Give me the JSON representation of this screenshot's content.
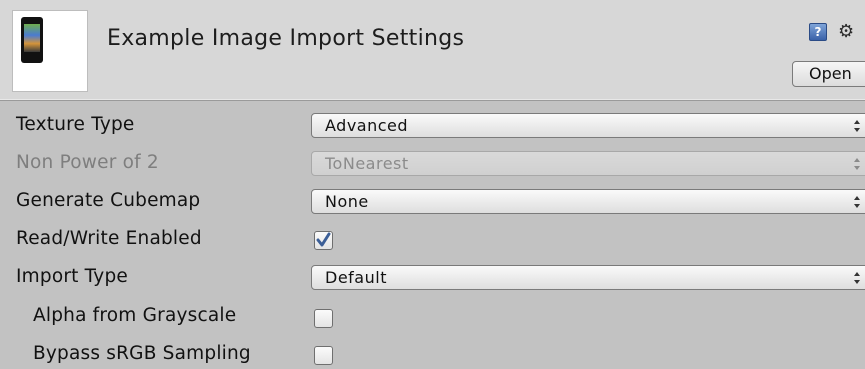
{
  "header": {
    "title": "Example Image Import Settings",
    "thumbnail_icon": "image-thumbnail-icon",
    "help_icon_glyph": "?",
    "gear_icon_glyph": "⚙",
    "open_label": "Open"
  },
  "settings": {
    "texture_type": {
      "label": "Texture Type",
      "value": "Advanced"
    },
    "non_power_of_2": {
      "label": "Non Power of 2",
      "value": "ToNearest",
      "disabled": true
    },
    "generate_cubemap": {
      "label": "Generate Cubemap",
      "value": "None"
    },
    "read_write_enabled": {
      "label": "Read/Write Enabled",
      "checked": true
    },
    "import_type": {
      "label": "Import Type",
      "value": "Default"
    },
    "alpha_from_grayscale": {
      "label": "Alpha from Grayscale",
      "checked": false
    },
    "bypass_srgb_sampling": {
      "label": "Bypass sRGB Sampling",
      "checked": false
    }
  },
  "colors": {
    "background": "#c2c2c2",
    "header_background": "#d7d7d7",
    "checkmark": "#3c5f97",
    "disabled_text": "#7e7e7e"
  }
}
